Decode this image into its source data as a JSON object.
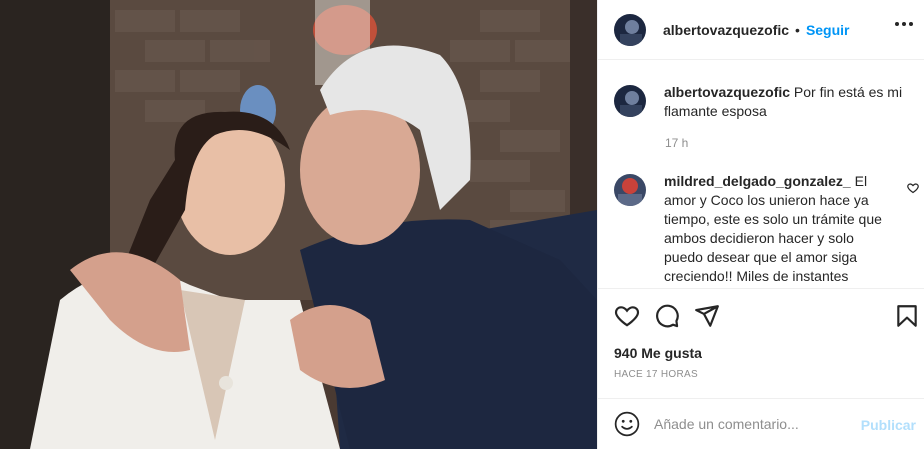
{
  "post": {
    "image_alt": "Foto de la publicación",
    "author": "albertovazquezofic",
    "follow_label": "Seguir",
    "separator": "•"
  },
  "caption": {
    "username": "albertovazquezofic",
    "text": "Por fin está es mi flamante esposa",
    "time": "17 h"
  },
  "comment": {
    "username": "mildred_delgado_gonzalez_",
    "text": "El amor y Coco los unieron hace ya tiempo, este es solo un trámite que ambos decidieron hacer y solo puedo desear que el amor siga creciendo!! Miles de instantes maravillosos"
  },
  "stats": {
    "likes": "940 Me gusta",
    "posted_ago": "HACE 17 HORAS"
  },
  "composer": {
    "placeholder": "Añade un comentario...",
    "publish_label": "Publicar"
  },
  "icons": [
    "heart-icon",
    "comment-icon",
    "share-icon",
    "bookmark-icon",
    "emoji-icon",
    "more-options-icon"
  ],
  "colors": {
    "accent": "#0095f6",
    "publish_disabled": "#b2dffc",
    "secondary_text": "#8e8e8e"
  }
}
